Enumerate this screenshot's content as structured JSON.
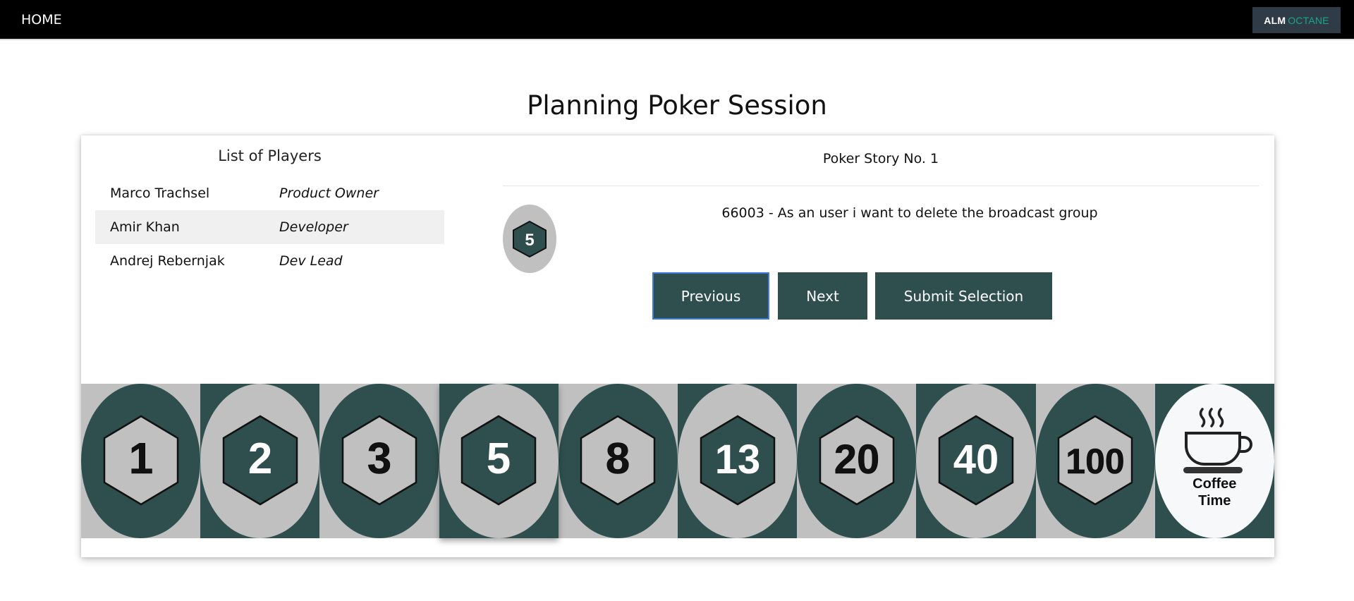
{
  "nav": {
    "home_label": "HOME",
    "logo_alm": "ALM",
    "logo_octane": "OCTANE"
  },
  "page": {
    "title": "Planning Poker Session"
  },
  "players": {
    "title": "List of Players",
    "rows": [
      {
        "name": "Marco Trachsel",
        "role": "Product Owner"
      },
      {
        "name": "Amir Khan",
        "role": "Developer"
      },
      {
        "name": "Andrej Rebernjak",
        "role": "Dev Lead"
      }
    ]
  },
  "story": {
    "title": "Poker Story No. 1",
    "text": "66003 - As an user i want to delete the broadcast group",
    "selected_value": "5"
  },
  "buttons": {
    "previous": "Previous",
    "next": "Next",
    "submit": "Submit Selection"
  },
  "cards": [
    {
      "value": "1",
      "bg": "#c0c0c0",
      "oval": "#2f4f4f",
      "hex": "#c0c0c0",
      "text": "#111111"
    },
    {
      "value": "2",
      "bg": "#2f4f4f",
      "oval": "#c0c0c0",
      "hex": "#2f4f4f",
      "text": "#ffffff"
    },
    {
      "value": "3",
      "bg": "#c0c0c0",
      "oval": "#2f4f4f",
      "hex": "#c0c0c0",
      "text": "#111111"
    },
    {
      "value": "5",
      "bg": "#2f4f4f",
      "oval": "#c0c0c0",
      "hex": "#2f4f4f",
      "text": "#ffffff",
      "selected": true
    },
    {
      "value": "8",
      "bg": "#c0c0c0",
      "oval": "#2f4f4f",
      "hex": "#c0c0c0",
      "text": "#111111"
    },
    {
      "value": "13",
      "bg": "#2f4f4f",
      "oval": "#c0c0c0",
      "hex": "#2f4f4f",
      "text": "#ffffff"
    },
    {
      "value": "20",
      "bg": "#c0c0c0",
      "oval": "#2f4f4f",
      "hex": "#c0c0c0",
      "text": "#111111"
    },
    {
      "value": "40",
      "bg": "#2f4f4f",
      "oval": "#c0c0c0",
      "hex": "#2f4f4f",
      "text": "#ffffff"
    },
    {
      "value": "100",
      "bg": "#c0c0c0",
      "oval": "#2f4f4f",
      "hex": "#c0c0c0",
      "text": "#111111"
    }
  ],
  "coffee_card": {
    "label_line1": "Coffee",
    "label_line2": "Time",
    "icon": "coffee-cup-icon",
    "bg": "#2f4f4f",
    "oval": "#f7f8fa"
  },
  "colors": {
    "primary": "#2f4f4f",
    "card_grey": "#c0c0c0",
    "focus_outline": "#3d7bd9"
  }
}
